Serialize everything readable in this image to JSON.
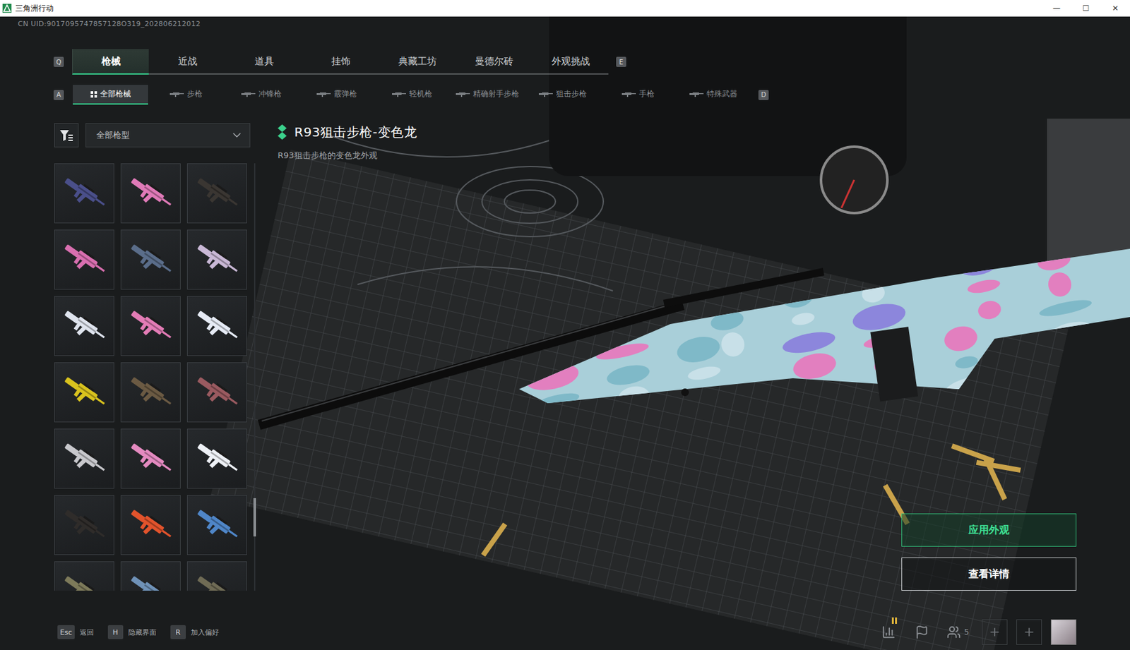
{
  "window": {
    "title": "三角洲行动",
    "controls": [
      "—",
      "☐",
      "✕"
    ]
  },
  "uid": "CN UID:9017095747857128O319_202806212012",
  "main_tabs": {
    "prev_key": "Q",
    "next_key": "E",
    "items": [
      {
        "label": "枪械",
        "selected": true
      },
      {
        "label": "近战",
        "selected": false
      },
      {
        "label": "道具",
        "selected": false
      },
      {
        "label": "挂饰",
        "selected": false
      },
      {
        "label": "典藏工坊",
        "selected": false
      },
      {
        "label": "曼德尔砖",
        "selected": false
      },
      {
        "label": "外观挑战",
        "selected": false
      }
    ]
  },
  "sub_tabs": {
    "prev_key": "A",
    "next_key": "D",
    "items": [
      {
        "label": "全部枪械",
        "selected": true
      },
      {
        "label": "步枪",
        "selected": false
      },
      {
        "label": "冲锋枪",
        "selected": false
      },
      {
        "label": "霰弹枪",
        "selected": false
      },
      {
        "label": "轻机枪",
        "selected": false
      },
      {
        "label": "精确射手步枪",
        "selected": false
      },
      {
        "label": "狙击步枪",
        "selected": false
      },
      {
        "label": "手枪",
        "selected": false
      },
      {
        "label": "特殊武器",
        "selected": false
      }
    ]
  },
  "filter": {
    "value": "全部枪型"
  },
  "skins": [
    {
      "color": "#4a4f8a"
    },
    {
      "color": "#e07ab8"
    },
    {
      "color": "#3a3632"
    },
    {
      "color": "#d96fb0"
    },
    {
      "color": "#5a6d8a"
    },
    {
      "color": "#c9b8d6"
    },
    {
      "color": "#dfe4ee"
    },
    {
      "color": "#e37cb6"
    },
    {
      "color": "#e6ebf5"
    },
    {
      "color": "#d8c21e"
    },
    {
      "color": "#6b5a43"
    },
    {
      "color": "#9a5a60"
    },
    {
      "color": "#c8c8cc"
    },
    {
      "color": "#e48ac0"
    },
    {
      "color": "#eef1f6"
    },
    {
      "color": "#2f2c2a"
    },
    {
      "color": "#e2532c"
    },
    {
      "color": "#4f86c8"
    },
    {
      "color": "#7d7a5a"
    },
    {
      "color": "#6f92b8"
    },
    {
      "color": "#6f6b55"
    }
  ],
  "scrollbar": {
    "level": 0.86
  },
  "item": {
    "title": "R93狙击步枪-变色龙",
    "description": "R93狙击步枪的变色龙外观"
  },
  "actions": [
    {
      "label": "应用外观",
      "primary": true
    },
    {
      "label": "查看详情",
      "primary": false
    }
  ],
  "hints": [
    {
      "key": "Esc",
      "label": "返回"
    },
    {
      "key": "H",
      "label": "隐藏界面"
    },
    {
      "key": "R",
      "label": "加入偏好"
    }
  ],
  "status": {
    "friends": "5"
  }
}
